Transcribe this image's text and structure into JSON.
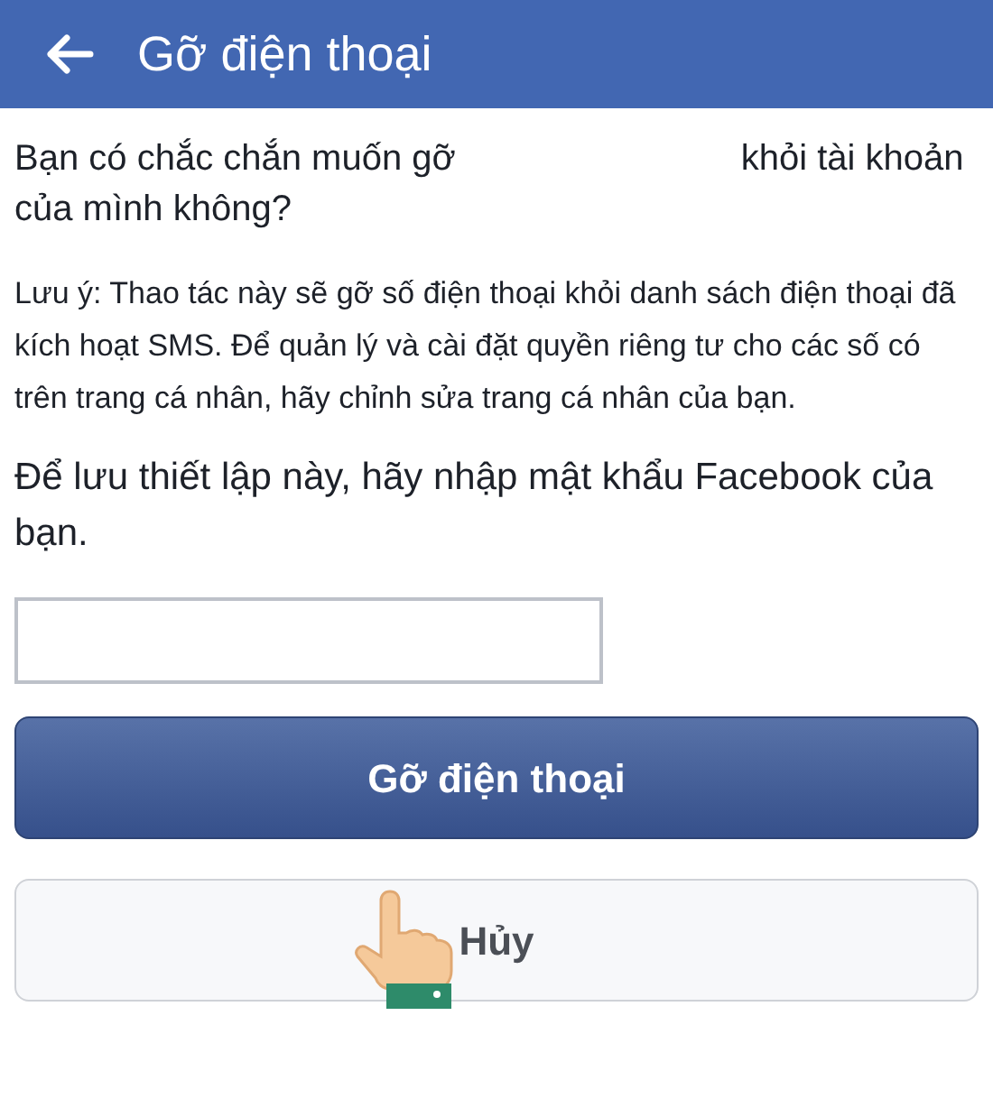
{
  "header": {
    "title": "Gỡ điện thoại"
  },
  "question": {
    "before": "Bạn có chắc chắn muốn gỡ",
    "after": "khỏi tài khoản của mình không?"
  },
  "note": "Lưu ý: Thao tác này sẽ gỡ số điện thoại khỏi danh sách điện thoại đã kích hoạt SMS. Để quản lý và cài đặt quyền riêng tư cho các số có trên trang cá nhân, hãy chỉnh sửa trang cá nhân của bạn.",
  "prompt": "Để lưu thiết lập này, hãy nhập mật khẩu Facebook của bạn.",
  "buttons": [
    {
      "kind": "primary",
      "label": "Gỡ điện thoại"
    },
    {
      "kind": "secondary",
      "label": "Hủy"
    }
  ]
}
